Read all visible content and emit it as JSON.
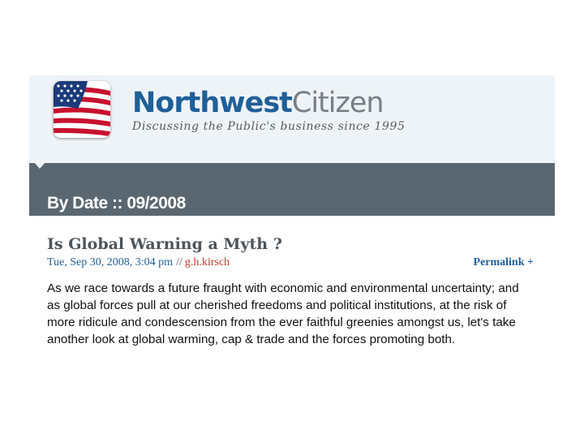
{
  "header": {
    "site_name_strong": "Northwest",
    "site_name_light": "Citizen",
    "tagline": "Discussing the Public's business since 1995",
    "logo_icon": "american-flag-icon"
  },
  "date_bar": {
    "title": "By Date :: 09/2008"
  },
  "post": {
    "title": "Is Global Warning a Myth ?",
    "date": "Tue, Sep 30, 2008, 3:04 pm",
    "separator": "//",
    "author": "g.h.kirsch",
    "permalink": "Permalink +",
    "body": "As we race towards a future fraught with economic and environmental uncertainty; and as global forces pull at our cherished freedoms and political institutions, at the risk of more ridicule and condescension from the ever faithful greenies amongst us, let's take another look at global warming, cap & trade and the forces promoting both."
  },
  "colors": {
    "header_bg": "#eef3f7",
    "date_bar_bg": "#5b6770",
    "brand_blue": "#1f5f98",
    "author_red": "#c0392b"
  }
}
